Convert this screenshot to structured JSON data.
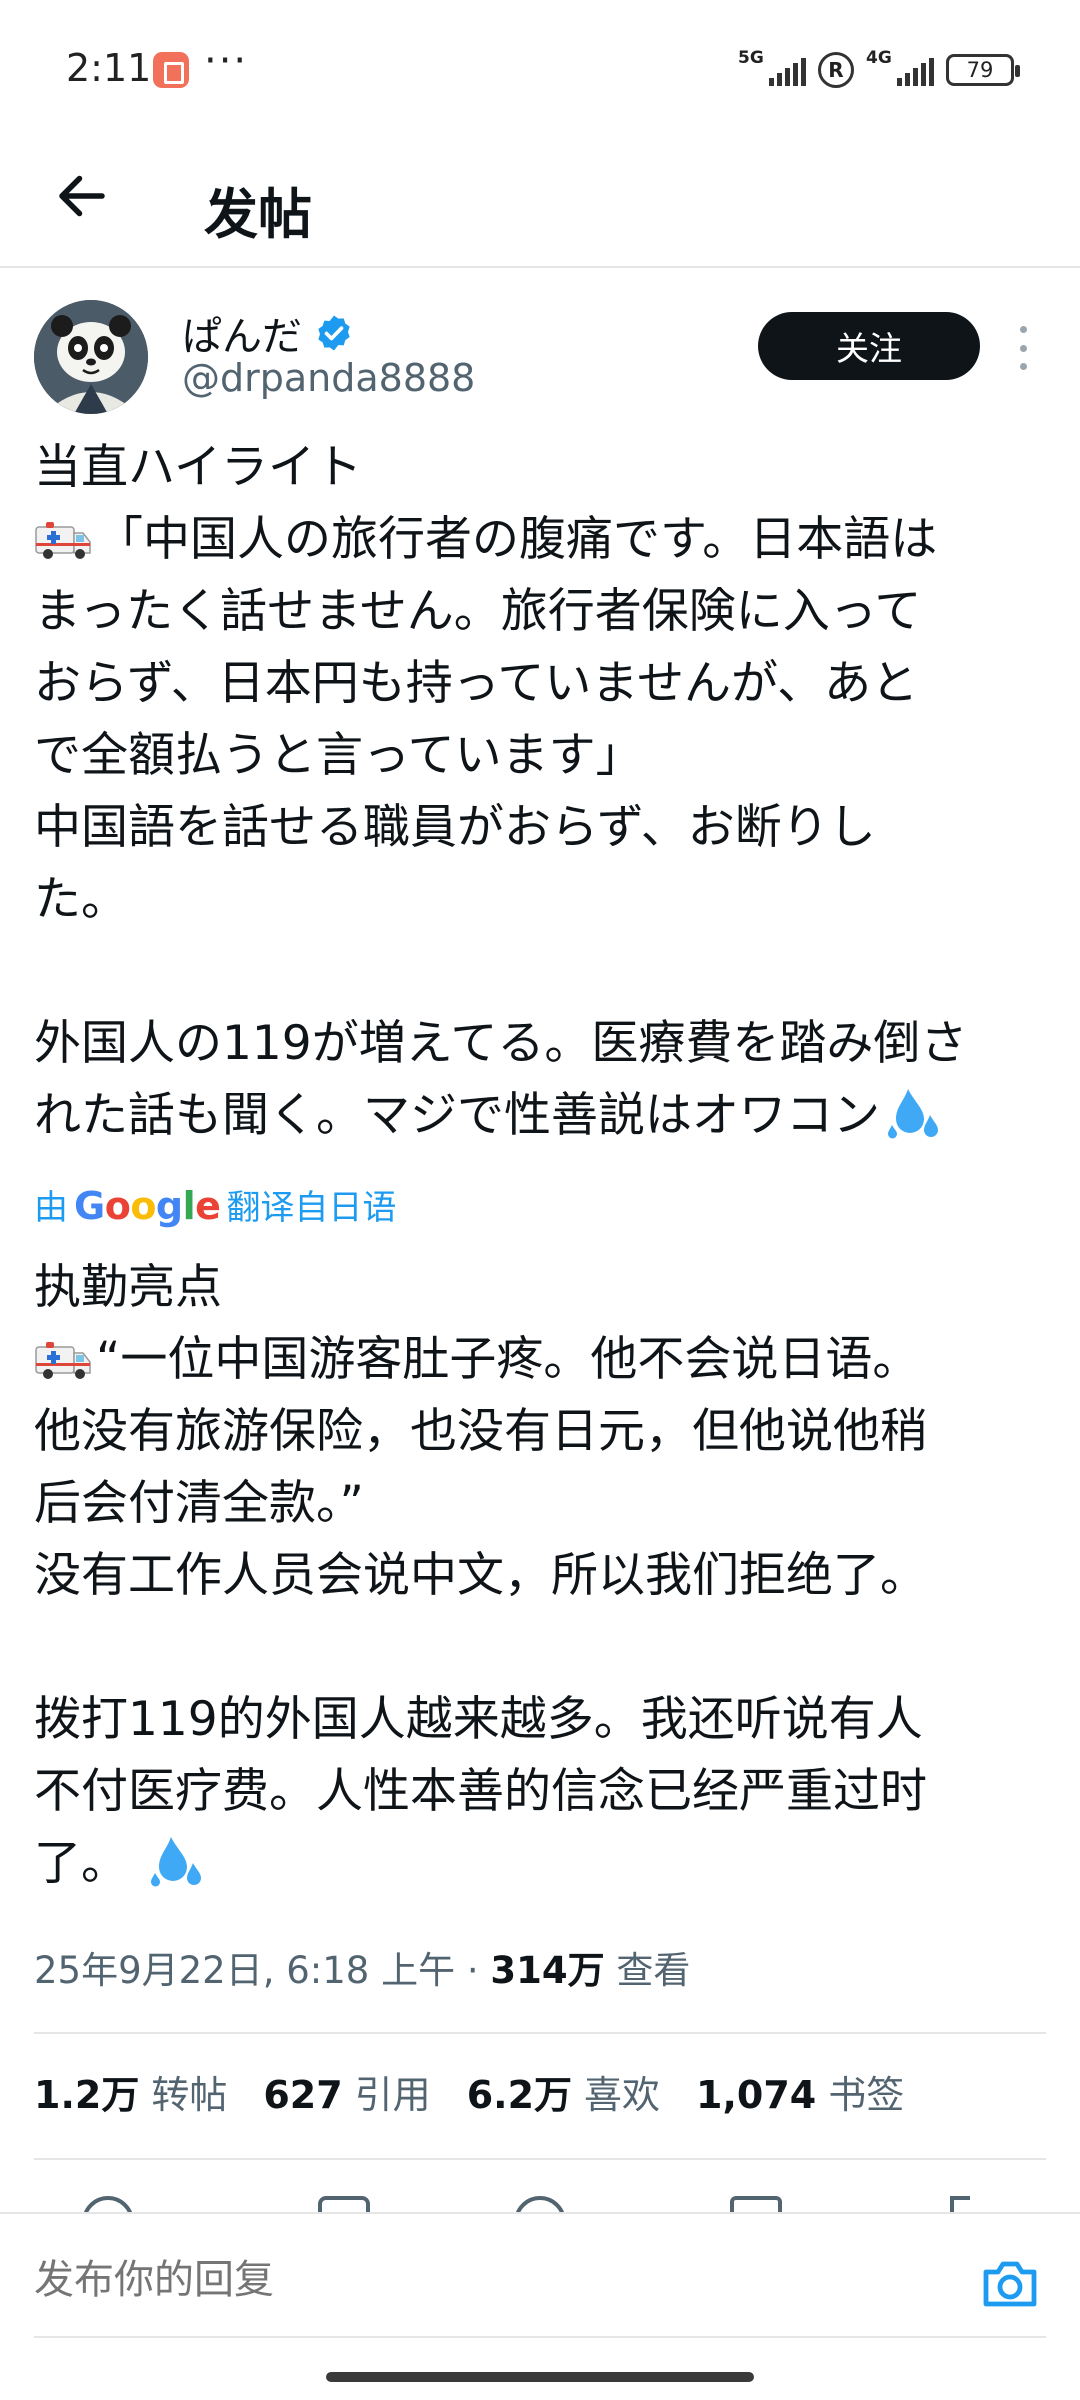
{
  "status_bar": {
    "time": "2:11",
    "more": "···",
    "net1": "5G",
    "roaming": "R",
    "net2": "4G",
    "battery": "79"
  },
  "header": {
    "title": "发帖"
  },
  "author": {
    "name": "ぱんだ",
    "handle": "@drpanda8888",
    "follow_label": "关注"
  },
  "tweet": {
    "lines": [
      "当直ハイライト",
      "「中国人の旅行者の腹痛です。日本語は",
      "まったく話せません。旅行者保険に入って",
      "おらず、日本円も持っていませんが、あと",
      "で全額払うと言っています」",
      "中国語を話せる職員がおらず、お断りし",
      "た。",
      "",
      "外国人の119が増えてる。医療費を踏み倒さ",
      "れた話も聞く。マジで性善説はオワコン"
    ]
  },
  "translation": {
    "prefix": "由",
    "brand": "Google",
    "suffix": "翻译自日语",
    "lines": [
      "执勤亮点",
      "“一位中国游客肚子疼。他不会说日语。",
      "他没有旅游保险，也没有日元，但他说他稍",
      "后会付清全款。”",
      "没有工作人员会说中文，所以我们拒绝了。",
      "",
      "拨打119的外国人越来越多。我还听说有人",
      "不付医疗费。人性本善的信念已经严重过时",
      "了。"
    ]
  },
  "meta": {
    "date": "25年9月22日, 6:18 上午 · ",
    "views_count": "314万",
    "views_label": " 查看"
  },
  "stats": [
    {
      "count": "1.2万",
      "label": "转帖"
    },
    {
      "count": "627",
      "label": "引用"
    },
    {
      "count": "6.2万",
      "label": "喜欢"
    },
    {
      "count": "1,074",
      "label": "书签"
    }
  ],
  "reply": {
    "placeholder": "发布你的回复"
  },
  "icons": {
    "back": "arrow-left-icon",
    "verified": "verified-badge-icon",
    "more": "more-vertical-icon",
    "camera": "camera-icon",
    "ambulance": "ambulance-emoji-icon",
    "sweat": "sweat-droplets-emoji-icon"
  },
  "colors": {
    "link": "#1d9bf0",
    "verified": "#1d9bf0",
    "primary_text": "#0f1419",
    "secondary_text": "#536471"
  }
}
